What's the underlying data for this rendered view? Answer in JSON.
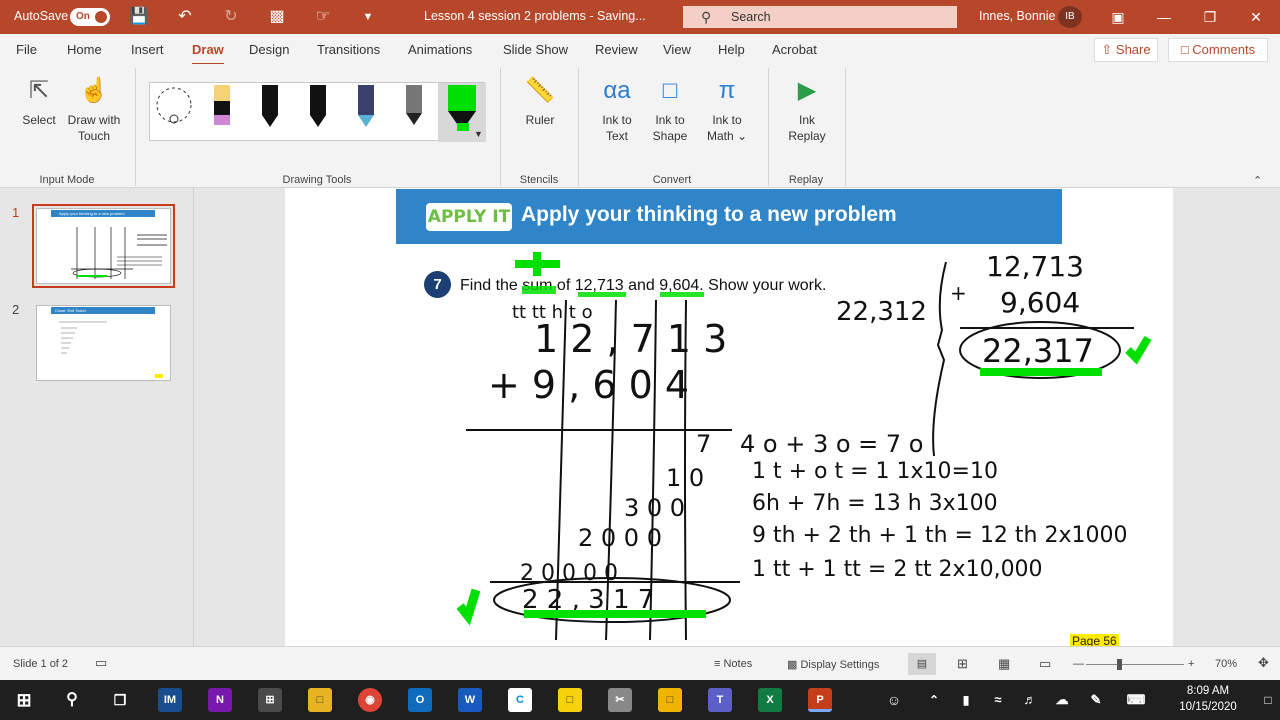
{
  "titlebar": {
    "autosave_label": "AutoSave",
    "autosave_state": "On",
    "doc_title": "Lesson 4 session 2 problems  -  Saving...",
    "search_placeholder": "Search",
    "user_name": "Innes, Bonnie",
    "user_initials": "IB"
  },
  "menu": {
    "tabs": [
      "File",
      "Home",
      "Insert",
      "Draw",
      "Design",
      "Transitions",
      "Animations",
      "Slide Show",
      "Review",
      "View",
      "Help",
      "Acrobat"
    ],
    "active": "Draw",
    "share": "Share",
    "comments": "Comments"
  },
  "ribbon": {
    "select": "Select",
    "draw_with_touch_1": "Draw with",
    "draw_with_touch_2": "Touch",
    "input_mode": "Input Mode",
    "drawing_tools": "Drawing Tools",
    "ruler": "Ruler",
    "stencils": "Stencils",
    "ink_to_text_1": "Ink to",
    "ink_to_text_2": "Text",
    "ink_to_shape_1": "Ink to",
    "ink_to_shape_2": "Shape",
    "ink_to_math_1": "Ink to",
    "ink_to_math_2": "Math",
    "convert": "Convert",
    "ink_replay_1": "Ink",
    "ink_replay_2": "Replay",
    "replay": "Replay"
  },
  "thumbs": [
    {
      "num": "1",
      "title": "Apply your thinking to a new problem"
    },
    {
      "num": "2",
      "title": "Close: Exit Ticket"
    }
  ],
  "slide": {
    "apply_badge": "APPLY IT",
    "banner_title": "Apply your thinking to a new problem",
    "q_number": "7",
    "q_text": "Find the sum of 12,713 and 9,604. Show your work.",
    "page_label": "Page 56",
    "ink": {
      "place_headers": "tt   tt   h   t   o",
      "row1": "1 2 , 7 1 3",
      "row2": "+   9 , 6 0 4",
      "partials": [
        "7",
        "1 0",
        "3 0 0",
        "2 0 0 0",
        "2 0 0 0 0"
      ],
      "total": "2 2 , 3 1 7",
      "notes": [
        "4 o + 3 o = 7 o",
        "1 t + o t = 1   1x10=10",
        "6h + 7h = 13 h   3x100",
        "9 th + 2 th + 1 th = 12 th   2x1000",
        "1 tt + 1 tt = 2 tt   2x10,000"
      ],
      "side_addend1": "12,713",
      "side_addend2": "9,604",
      "side_sum": "22,317",
      "side_estimate": "22,312",
      "plus": "+"
    }
  },
  "status": {
    "slide_of": "Slide 1 of 2",
    "notes": "Notes",
    "display_settings": "Display Settings",
    "zoom": "70%"
  },
  "clock": {
    "time": "8:09 AM",
    "date": "10/15/2020"
  },
  "colors": {
    "accent": "#b7472a",
    "banner": "#2f85c7",
    "highlight": "#00e000"
  }
}
